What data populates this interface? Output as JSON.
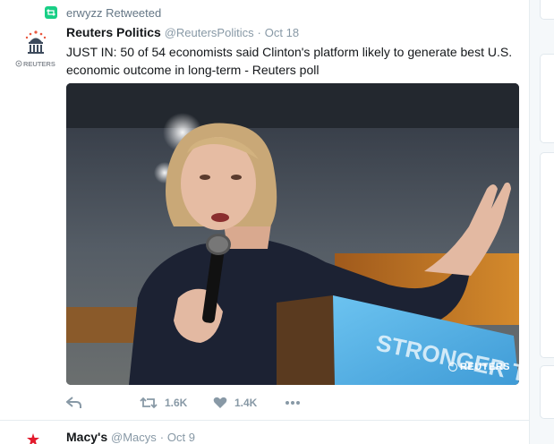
{
  "retweet_context": {
    "user": "erwyzz",
    "action": "Retweeted"
  },
  "tweet": {
    "fullname": "Reuters Politics",
    "handle": "@ReutersPolitics",
    "separator": "·",
    "timestamp": "Oct 18",
    "avatar_caption": "REUTERS",
    "text": "JUST IN: 50 of 54 economists said Clinton's platform likely to generate best U.S. economic outcome in long-term - Reuters poll",
    "media": {
      "podium_text": "STRONGER TOGETHER",
      "watermark": "REUTERS"
    },
    "actions": {
      "retweet_count": "1.6K",
      "like_count": "1.4K"
    }
  },
  "next_tweet": {
    "fullname": "Macy's",
    "handle": "@Macys",
    "separator": "·",
    "timestamp": "Oct 9"
  },
  "colors": {
    "retweet_green": "#19cf86",
    "meta_gray": "#8899a6",
    "macys_red": "#e21a2c",
    "podium_blue": "#5ab4e6"
  },
  "icons": [
    "retweet-context-icon",
    "reply-icon",
    "retweet-icon",
    "like-icon",
    "more-icon"
  ]
}
